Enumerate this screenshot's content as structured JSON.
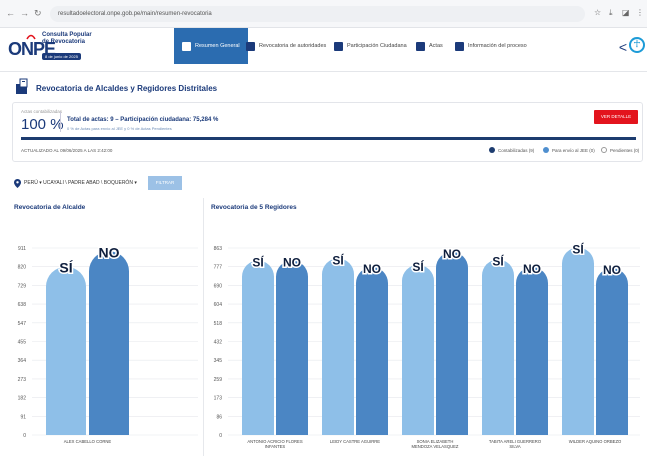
{
  "browser": {
    "url": "resultadoelectoral.onpe.gob.pe/main/resumen-revocatoria"
  },
  "header": {
    "logo_word": "ONPE",
    "title": "Consulta Popular de Revocatoria",
    "date_badge": "8 de junio de 2025",
    "nav": [
      {
        "label": "Resumen General",
        "active": true
      },
      {
        "label": "Revocatoria de autoridades",
        "active": false
      },
      {
        "label": "Participación Ciudadana",
        "active": false
      },
      {
        "label": "Actas",
        "active": false
      },
      {
        "label": "Información del proceso",
        "active": false
      }
    ]
  },
  "page_title": "Revocatoria de Alcaldes y Regidores Distritales",
  "summary": {
    "actas_label": "Actas contabilizadas",
    "actas_pct": "100 %",
    "total": "Total de actas: 9 – Participación ciudadana: 75,284 %",
    "sub": "0 % de Actas para envío al JEE y 0 % de Actas Pendientes",
    "button": "VER DETALLE",
    "progress_fraction": 1.0,
    "updated": "ACTUALIZADO AL 09/06/2025 A LAS 2:42:00",
    "legend": [
      {
        "label": "Contabilizadas (9)",
        "color": "#1d3c6f"
      },
      {
        "label": "Para envío al JEE (0)",
        "color": "#4f8fcf"
      },
      {
        "label": "Pendientes (0)",
        "color": "#ffffff"
      }
    ]
  },
  "filter": {
    "location": "PERÚ  ▾  UCAYALI  \\  PADRE ABAD  \\  BOQUERÓN  ▾",
    "button": "FILTRAR"
  },
  "chart_data": [
    {
      "type": "bar",
      "title": "Revocatoria de Alcalde",
      "categories": [
        "ALEX CABELLO CORNE"
      ],
      "yticks": [
        "0",
        "91",
        "182",
        "273",
        "364",
        "455",
        "547",
        "638",
        "729",
        "820",
        "911"
      ],
      "ylim": [
        0,
        911
      ],
      "series": [
        {
          "name": "SÍ",
          "values": [
            820
          ],
          "color": "#8ebfe8"
        },
        {
          "name": "NO",
          "values": [
            895
          ],
          "color": "#4b86c4"
        }
      ]
    },
    {
      "type": "bar",
      "title": "Revocatoria de 5 Regidores",
      "categories": [
        "ANTONIO ACRICIO FLORES INFANTES",
        "LEIDY CASTRE AGUIRRE",
        "SONIA ELIZABETH MENDOZA VELASQUEZ",
        "TABITA ARELI GUERRERO SILVA",
        "WILDER AQUINO ORBEZO"
      ],
      "yticks": [
        "0",
        "86",
        "173",
        "259",
        "345",
        "432",
        "518",
        "604",
        "690",
        "777",
        "863"
      ],
      "ylim": [
        0,
        863
      ],
      "series": [
        {
          "name": "SÍ",
          "values": [
            805,
            815,
            785,
            810,
            865
          ],
          "color": "#8ebfe8"
        },
        {
          "name": "NO",
          "values": [
            805,
            775,
            845,
            775,
            770
          ],
          "color": "#4b86c4"
        }
      ]
    }
  ]
}
